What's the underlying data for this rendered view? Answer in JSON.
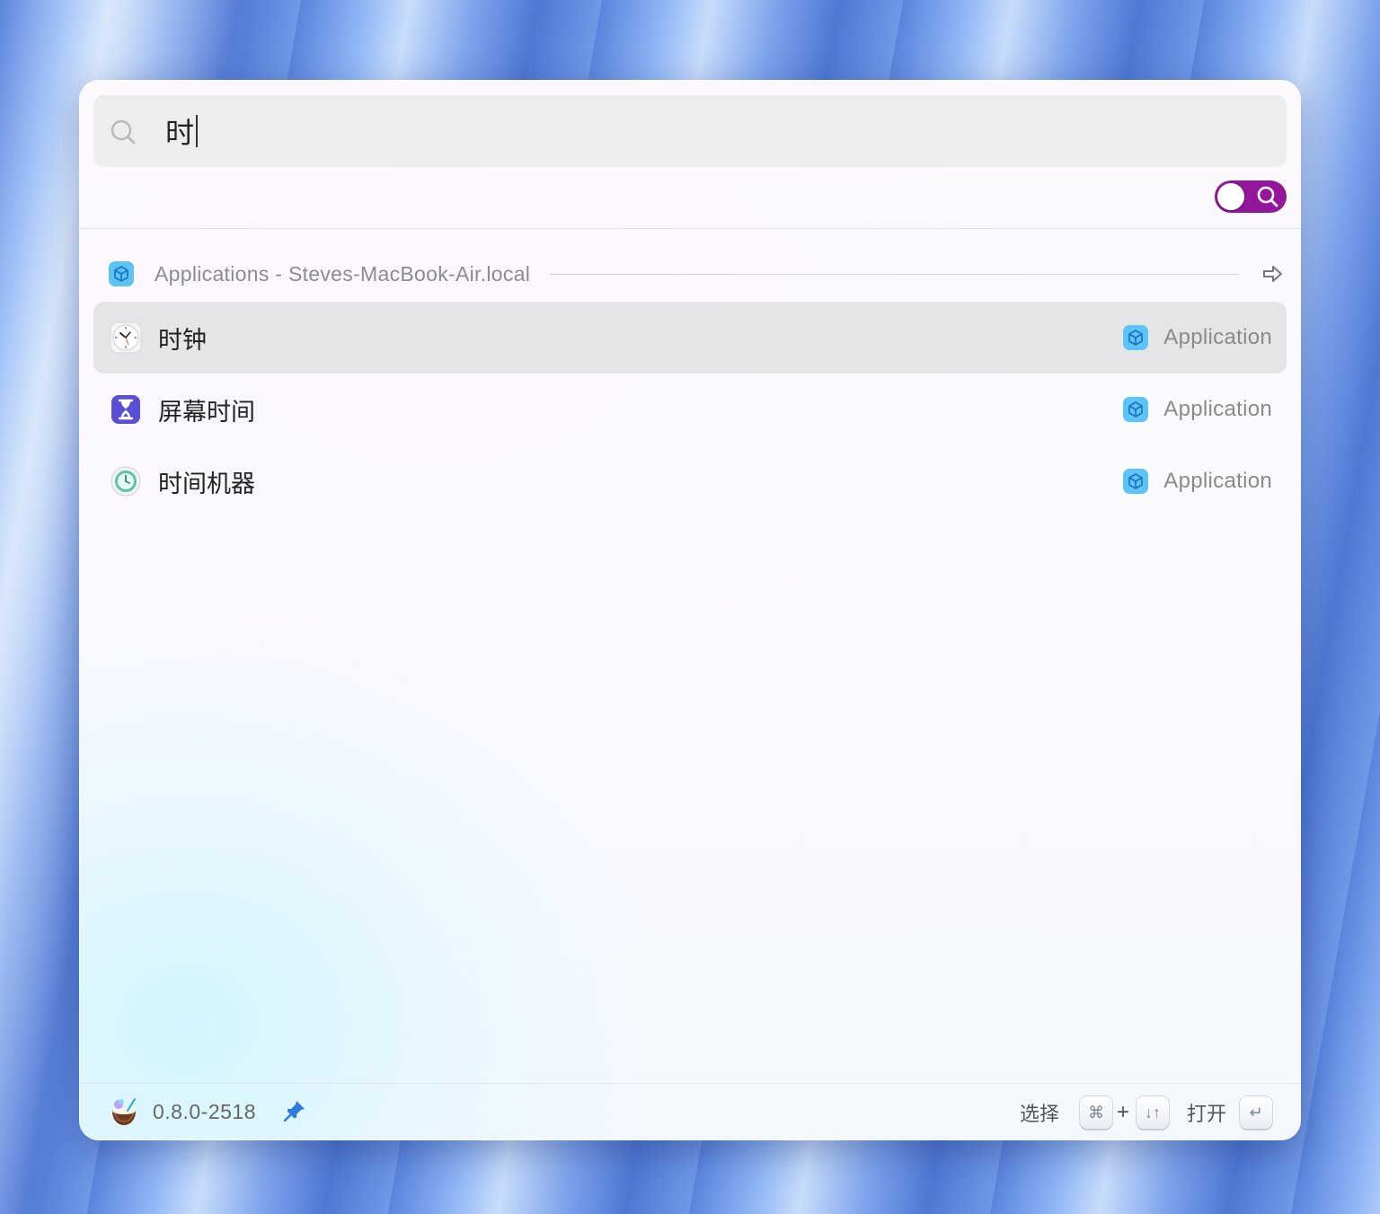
{
  "search": {
    "query": "时",
    "search_mode_enabled": true,
    "accent_color": "#92179a"
  },
  "group": {
    "title": "Applications - Steves-MacBook-Air.local",
    "icon": "app-cube-icon",
    "action_icon": "arrow-right-icon"
  },
  "results": [
    {
      "title": "时钟",
      "kind": "Application",
      "icon": "clock-app-icon",
      "selected": true
    },
    {
      "title": "屏幕时间",
      "kind": "Application",
      "icon": "hourglass-app-icon",
      "selected": false
    },
    {
      "title": "时间机器",
      "kind": "Application",
      "icon": "time-machine-app-icon",
      "selected": false
    }
  ],
  "footer": {
    "version": "0.8.0-2518",
    "select_label": "选择",
    "select_keys": [
      "⌘",
      "↓↑"
    ],
    "plus": "+",
    "open_label": "打开",
    "open_key": "↵"
  }
}
